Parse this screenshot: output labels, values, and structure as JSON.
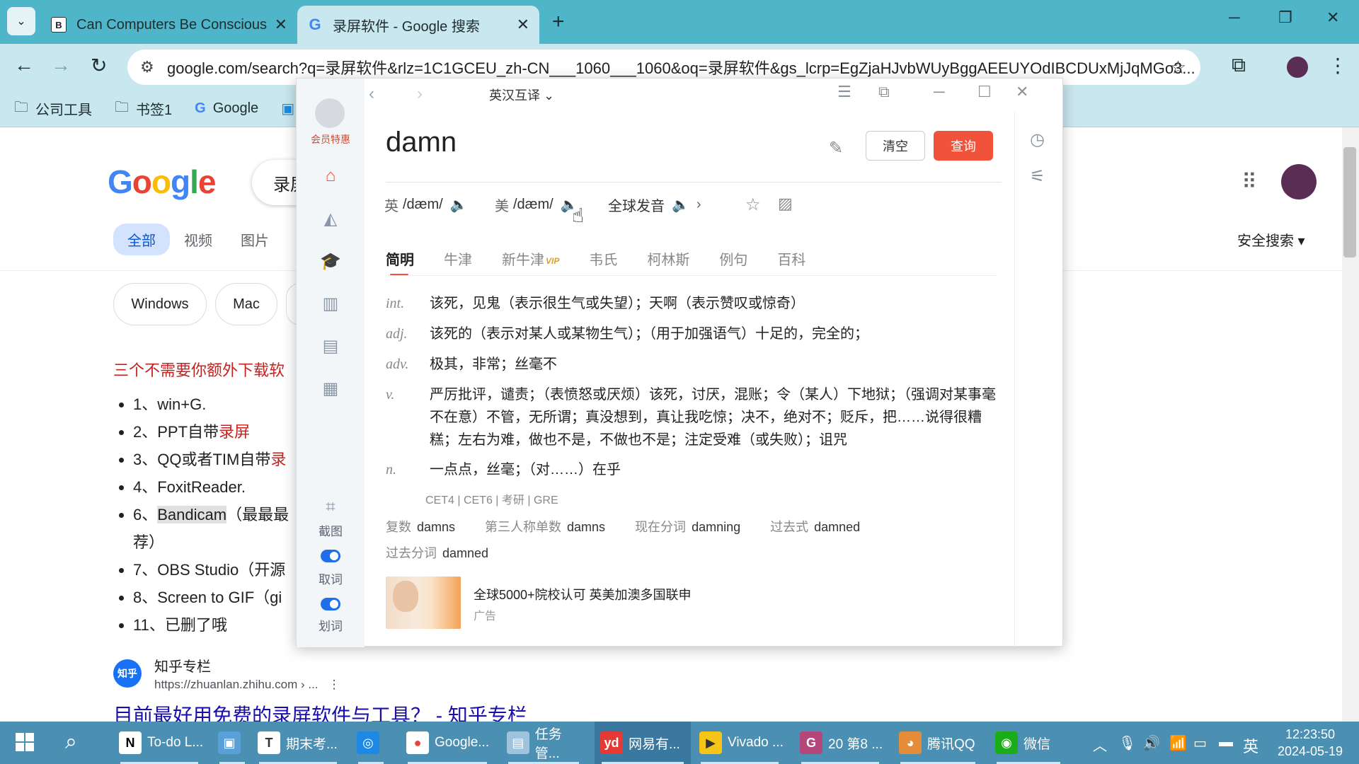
{
  "browser": {
    "tabs": [
      {
        "title": "Can Computers Be Conscious",
        "favicon": "B"
      },
      {
        "title": "录屏软件 - Google 搜索",
        "favicon": "G"
      }
    ],
    "url": "google.com/search?q=录屏软件&rlz=1C1GCEU_zh-CN___1060___1060&oq=录屏软件&gs_lcrp=EgZjaHJvbWUyBggAEEUYOdIBCDUxMjJqMGo3...",
    "bookmarks": [
      "公司工具",
      "书签1",
      "Google"
    ]
  },
  "google": {
    "logo_letters": [
      "G",
      "o",
      "o",
      "g",
      "l",
      "e"
    ],
    "search_text": "录屏",
    "tabs": [
      "全部",
      "视频",
      "图片"
    ],
    "safe_search": "安全搜索",
    "chips": [
      "Windows",
      "Mac"
    ],
    "result_title": "三个不需要你额外下载软",
    "bullets": [
      {
        "pre": "1、win+G.",
        "hl": "",
        "red": "",
        "post": ""
      },
      {
        "pre": "2、PPT自带",
        "hl": "",
        "red": "录屏",
        "post": ""
      },
      {
        "pre": "3、QQ或者TIM自带",
        "hl": "",
        "red": "录",
        "post": ""
      },
      {
        "pre": "4、FoxitReader.",
        "hl": "",
        "red": "",
        "post": ""
      },
      {
        "pre": "6、",
        "hl": "Bandicam",
        "red": "",
        "post": "（最最最"
      },
      {
        "pre": "荐）",
        "hl": "",
        "red": "",
        "post": ""
      },
      {
        "pre": "7、OBS Studio（开源",
        "hl": "",
        "red": "",
        "post": ""
      },
      {
        "pre": "8、Screen to GIF（gi",
        "hl": "",
        "red": "",
        "post": ""
      },
      {
        "pre": "11、已删了哦",
        "hl": "",
        "red": "",
        "post": ""
      }
    ],
    "zhihu": {
      "icon": "知乎",
      "name": "知乎专栏",
      "url": "https://zhuanlan.zhihu.com › ...",
      "title": "目前最好用免费的录屏软件与工具？ - 知乎专栏"
    }
  },
  "youdao": {
    "mode": "英汉互译",
    "vip_label": "会员特惠",
    "side_labels": {
      "screenshot": "截图",
      "pick": "取词",
      "select": "划词"
    },
    "word": "damn",
    "clear_label": "清空",
    "query_label": "查询",
    "phonetic": {
      "uk_label": "英",
      "uk": "/dæm/",
      "us_label": "美",
      "us": "/dæm/",
      "global_label": "全球发音"
    },
    "tabs": [
      "简明",
      "牛津",
      "新牛津",
      "韦氏",
      "柯林斯",
      "例句",
      "百科"
    ],
    "vip_badge": "VIP",
    "definitions": [
      {
        "pos": "int.",
        "text": "该死，见鬼（表示很生气或失望）；天啊（表示赞叹或惊奇）"
      },
      {
        "pos": "adj.",
        "text": "该死的（表示对某人或某物生气）；（用于加强语气）十足的，完全的；"
      },
      {
        "pos": "adv.",
        "text": "极其，非常；丝毫不"
      },
      {
        "pos": "v.",
        "text": "严厉批评，谴责；（表愤怒或厌烦）该死，讨厌，混账；令（某人）下地狱；（强调对某事毫不在意）不管，无所谓；真没想到，真让我吃惊；决不，绝对不；贬斥，把……说得很糟糕；左右为难，做也不是，不做也不是；注定受难（或失败）；诅咒"
      },
      {
        "pos": "n.",
        "text": "一点点，丝毫；（对……）在乎"
      }
    ],
    "exams": "CET4 | CET6 | 考研 | GRE",
    "forms": [
      {
        "label": "复数",
        "value": "damns"
      },
      {
        "label": "第三人称单数",
        "value": "damns"
      },
      {
        "label": "现在分词",
        "value": "damning"
      },
      {
        "label": "过去式",
        "value": "damned"
      },
      {
        "label": "过去分词",
        "value": "damned"
      }
    ],
    "ad": {
      "text": "全球5000+院校认可 英美加澳多国联申",
      "label": "广告"
    }
  },
  "taskbar": {
    "items": [
      {
        "label": "To-do L...",
        "icon": "N",
        "bg": "#ffffff",
        "fg": "#000000"
      },
      {
        "label": "",
        "icon": "▣",
        "bg": "#5aa0d8",
        "fg": "#ffffff"
      },
      {
        "label": "期末考...",
        "icon": "T",
        "bg": "#ffffff",
        "fg": "#333333"
      },
      {
        "label": "",
        "icon": "◎",
        "bg": "#1e88e5",
        "fg": "#ffffff"
      },
      {
        "label": "Google...",
        "icon": "●",
        "bg": "#ffffff",
        "fg": "#ea4335"
      },
      {
        "label": "任务管...",
        "icon": "▤",
        "bg": "#9fc3dc",
        "fg": "#ffffff"
      },
      {
        "label": "网易有...",
        "icon": "yd",
        "bg": "#e53935",
        "fg": "#ffffff"
      },
      {
        "label": "Vivado ...",
        "icon": "▶",
        "bg": "#f5c518",
        "fg": "#333333"
      },
      {
        "label": "20 第8 ...",
        "icon": "G",
        "bg": "#b5467a",
        "fg": "#ffffff"
      },
      {
        "label": "腾讯QQ",
        "icon": "◕",
        "bg": "#e58c3a",
        "fg": "#ffffff"
      },
      {
        "label": "微信",
        "icon": "◉",
        "bg": "#1aad19",
        "fg": "#ffffff"
      }
    ],
    "ime": "英",
    "time": "12:23:50",
    "date": "2024-05-19"
  }
}
